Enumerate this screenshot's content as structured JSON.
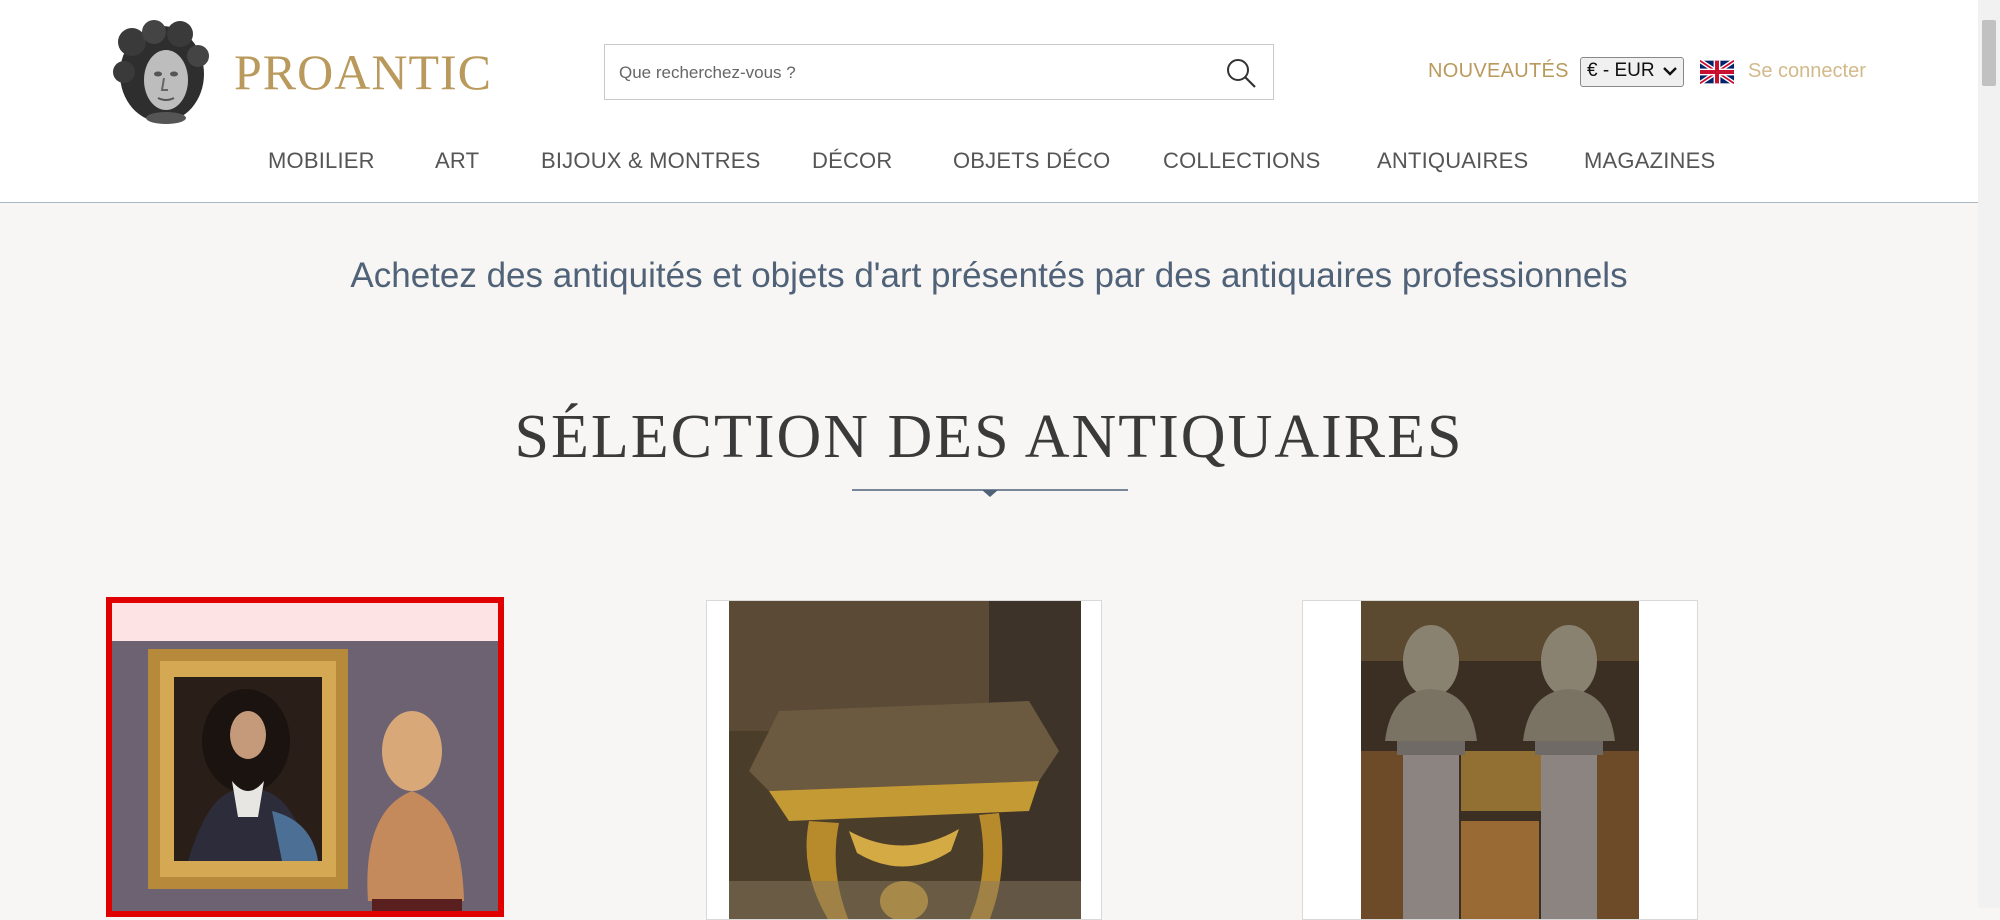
{
  "header": {
    "logo_text": "PROANTIC",
    "search_placeholder": "Que recherchez-vous ?",
    "nouveautes": "NOUVEAUTÉS",
    "currency": "€ - EUR",
    "language_flag": "uk-flag-icon",
    "login": "Se connecter"
  },
  "nav": {
    "items": [
      "MOBILIER",
      "ART",
      "BIJOUX & MONTRES",
      "DÉCOR",
      "OBJETS DÉCO",
      "COLLECTIONS",
      "ANTIQUAIRES",
      "MAGAZINES"
    ]
  },
  "main": {
    "tagline": "Achetez des antiquités et objets d'art présentés par des antiquaires professionnels",
    "section_title": "SÉLECTION DES ANTIQUAIRES"
  },
  "colors": {
    "brand_gold": "#b99a5c",
    "tagline_blue": "#4f6278",
    "selection_red": "#e00000"
  }
}
